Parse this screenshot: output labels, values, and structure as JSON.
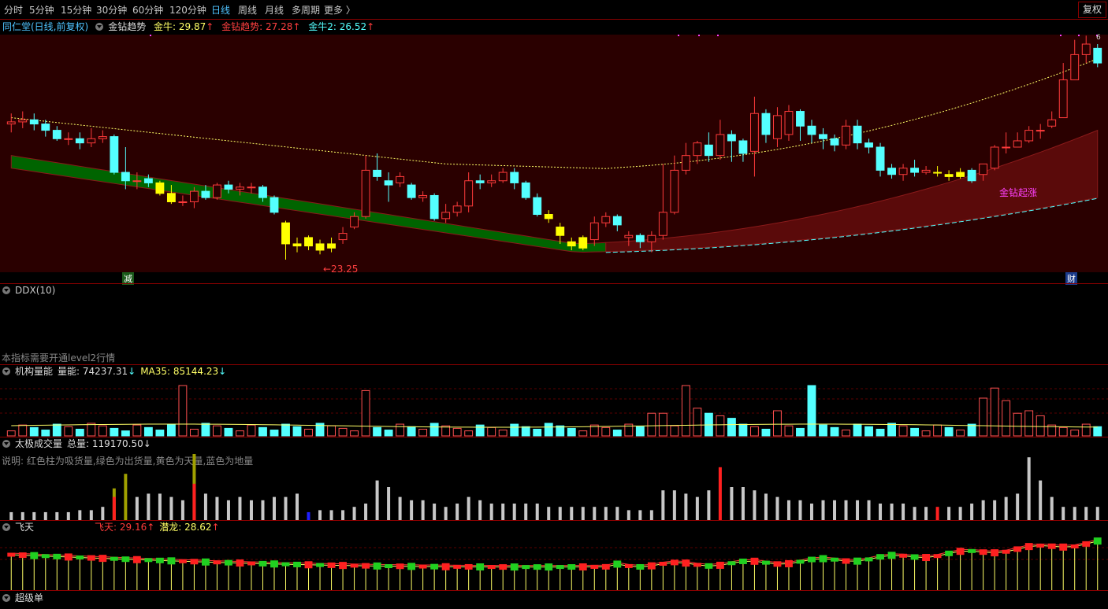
{
  "periods": [
    "分时",
    "5分钟",
    "15分钟",
    "30分钟",
    "60分钟",
    "120分钟",
    "日线",
    "周线",
    "月线",
    "多周期",
    "更多 〉"
  ],
  "active_period": "日线",
  "adjust_button": "复权",
  "main_panel": {
    "stock": "同仁堂(日线,前复权)",
    "indicator": "金钻趋势",
    "jinniu": "金牛: 29.87",
    "qushi": "金钻趋势: 27.28",
    "jinniu2": "金牛2: 26.52",
    "low_label": "←23.25",
    "signal_label": "金钻起涨",
    "marker_left": "减",
    "marker_right": "财",
    "marker_top": "6"
  },
  "ddx_panel": {
    "title": "DDX(10)",
    "note": "本指标需要开通level2行情"
  },
  "jgln_panel": {
    "title": "机构量能",
    "value": "量能: 74237.31",
    "ma": "MA35: 85144.23"
  },
  "tjcjl_panel": {
    "title": "太极成交量",
    "total": "总量: 119170.50",
    "desc": "说明: 红色柱为吸货量,绿色为出货量,黄色为天量,蓝色为地量"
  },
  "feitian_panel": {
    "title": "飞天",
    "feitian": "飞天: 29.16",
    "qianlong": "潜龙: 28.62"
  },
  "chaoji_panel": {
    "title": "超级单"
  },
  "colors": {
    "up": "#ff3b3b",
    "down": "#54ffff",
    "yellow": "#ffff00",
    "band_green": "#006400",
    "band_red": "#5a0a0a",
    "bg_main": "#2a0000"
  },
  "chart_data": {
    "type": "candlestick",
    "candles": [
      [
        29.7,
        29.8,
        30.2,
        29.3
      ],
      [
        29.8,
        29.9,
        30.3,
        29.5
      ],
      [
        29.9,
        29.7,
        30.2,
        29.4
      ],
      [
        29.7,
        29.4,
        29.9,
        29.1
      ],
      [
        29.4,
        29.0,
        29.6,
        28.9
      ],
      [
        29.0,
        29.0,
        29.3,
        28.7
      ],
      [
        29.0,
        28.8,
        29.3,
        28.5
      ],
      [
        28.8,
        29.0,
        29.5,
        28.6
      ],
      [
        29.0,
        29.1,
        29.4,
        28.8
      ],
      [
        29.1,
        27.4,
        29.2,
        27.3
      ],
      [
        27.4,
        27.0,
        28.6,
        26.6
      ],
      [
        27.0,
        27.0,
        27.4,
        26.6
      ],
      [
        27.1,
        26.9,
        27.3,
        26.7
      ],
      [
        26.9,
        26.4,
        27.0,
        26.3
      ],
      [
        26.4,
        26.0,
        26.8,
        25.9
      ],
      [
        26.0,
        26.0,
        26.3,
        25.8
      ],
      [
        26.0,
        26.5,
        26.7,
        25.7
      ],
      [
        26.5,
        26.2,
        26.8,
        26.1
      ],
      [
        26.2,
        26.8,
        26.9,
        26.1
      ],
      [
        26.8,
        26.6,
        27.0,
        26.4
      ],
      [
        26.6,
        26.7,
        26.9,
        26.3
      ],
      [
        26.7,
        26.7,
        26.9,
        26.4
      ],
      [
        26.7,
        26.2,
        26.8,
        26.0
      ],
      [
        26.2,
        25.5,
        26.3,
        25.4
      ],
      [
        25.0,
        24.0,
        25.1,
        23.25
      ],
      [
        24.0,
        23.9,
        24.3,
        23.6
      ],
      [
        23.9,
        24.3,
        24.4,
        23.7
      ],
      [
        24.0,
        23.7,
        24.2,
        23.5
      ],
      [
        23.8,
        24.0,
        24.3,
        23.6
      ],
      [
        24.2,
        24.5,
        24.8,
        24.0
      ],
      [
        24.8,
        25.3,
        25.5,
        24.7
      ],
      [
        25.3,
        27.5,
        28.2,
        25.2
      ],
      [
        27.5,
        27.2,
        28.3,
        27.0
      ],
      [
        27.0,
        26.8,
        27.4,
        26.0
      ],
      [
        26.9,
        27.2,
        27.4,
        26.7
      ],
      [
        26.8,
        26.2,
        26.9,
        26.1
      ],
      [
        26.2,
        26.3,
        26.5,
        26.0
      ],
      [
        26.3,
        25.2,
        26.4,
        25.1
      ],
      [
        25.2,
        25.5,
        25.9,
        25.0
      ],
      [
        25.5,
        25.8,
        26.0,
        25.3
      ],
      [
        25.8,
        27.0,
        27.4,
        25.5
      ],
      [
        27.0,
        26.9,
        27.3,
        26.6
      ],
      [
        26.9,
        27.0,
        27.3,
        26.7
      ],
      [
        27.0,
        27.4,
        27.6,
        26.9
      ],
      [
        27.4,
        26.9,
        27.6,
        26.6
      ],
      [
        26.9,
        26.2,
        27.0,
        26.1
      ],
      [
        26.2,
        25.4,
        26.4,
        25.3
      ],
      [
        25.4,
        25.2,
        25.6,
        25.0
      ],
      [
        24.8,
        24.4,
        25.0,
        24.0
      ],
      [
        24.1,
        23.9,
        24.3,
        23.7
      ],
      [
        23.8,
        24.3,
        24.4,
        23.7
      ],
      [
        24.2,
        25.0,
        25.3,
        23.9
      ],
      [
        25.0,
        25.3,
        25.5,
        24.8
      ],
      [
        25.3,
        24.9,
        25.4,
        24.6
      ],
      [
        24.3,
        24.4,
        24.6,
        23.9
      ],
      [
        24.4,
        24.1,
        24.5,
        23.8
      ],
      [
        24.1,
        24.4,
        24.6,
        23.6
      ],
      [
        24.4,
        25.5,
        27.8,
        24.2
      ],
      [
        25.5,
        27.5,
        28.2,
        25.4
      ],
      [
        27.5,
        28.2,
        28.8,
        27.3
      ],
      [
        28.2,
        28.8,
        28.9,
        27.8
      ],
      [
        28.7,
        28.2,
        29.3,
        27.9
      ],
      [
        28.2,
        29.2,
        29.9,
        28.0
      ],
      [
        29.2,
        28.9,
        29.4,
        27.9
      ],
      [
        28.9,
        28.3,
        29.0,
        27.9
      ],
      [
        28.4,
        30.2,
        31.0,
        27.2
      ],
      [
        30.2,
        29.2,
        30.4,
        28.8
      ],
      [
        29.0,
        30.1,
        30.5,
        28.6
      ],
      [
        29.2,
        30.3,
        30.6,
        28.9
      ],
      [
        30.3,
        29.6,
        30.4,
        28.9
      ],
      [
        29.6,
        29.2,
        29.9,
        28.8
      ],
      [
        29.2,
        29.0,
        29.5,
        28.5
      ],
      [
        29.0,
        28.7,
        29.2,
        28.4
      ],
      [
        28.7,
        29.6,
        29.9,
        28.5
      ],
      [
        29.6,
        28.8,
        29.9,
        28.5
      ],
      [
        28.8,
        28.6,
        29.0,
        28.3
      ],
      [
        28.6,
        27.5,
        28.8,
        27.2
      ],
      [
        27.6,
        27.3,
        27.8,
        27.1
      ],
      [
        27.3,
        27.6,
        27.8,
        27.0
      ],
      [
        27.6,
        27.4,
        28.0,
        27.2
      ],
      [
        27.4,
        27.5,
        27.7,
        27.3
      ],
      [
        27.4,
        27.4,
        27.7,
        27.2
      ],
      [
        27.3,
        27.2,
        27.5,
        27.0
      ],
      [
        27.2,
        27.4,
        27.6,
        27.1
      ],
      [
        27.5,
        27.0,
        27.6,
        26.9
      ],
      [
        27.3,
        27.8,
        27.8,
        27.0
      ],
      [
        27.6,
        28.6,
        28.7,
        27.5
      ],
      [
        28.6,
        28.6,
        29.3,
        28.3
      ],
      [
        28.6,
        28.9,
        29.3,
        28.6
      ],
      [
        28.9,
        29.4,
        29.6,
        28.8
      ],
      [
        29.4,
        29.4,
        29.7,
        29.0
      ],
      [
        29.6,
        29.9,
        30.3,
        29.5
      ],
      [
        30.0,
        31.8,
        32.6,
        30.3
      ],
      [
        31.8,
        33.0,
        33.7,
        31.9
      ],
      [
        33.0,
        33.5,
        33.9,
        32.6
      ],
      [
        33.3,
        32.6,
        33.5,
        32.4
      ]
    ],
    "xrange_count": 91,
    "ylim": [
      22.8,
      33.8
    ]
  }
}
